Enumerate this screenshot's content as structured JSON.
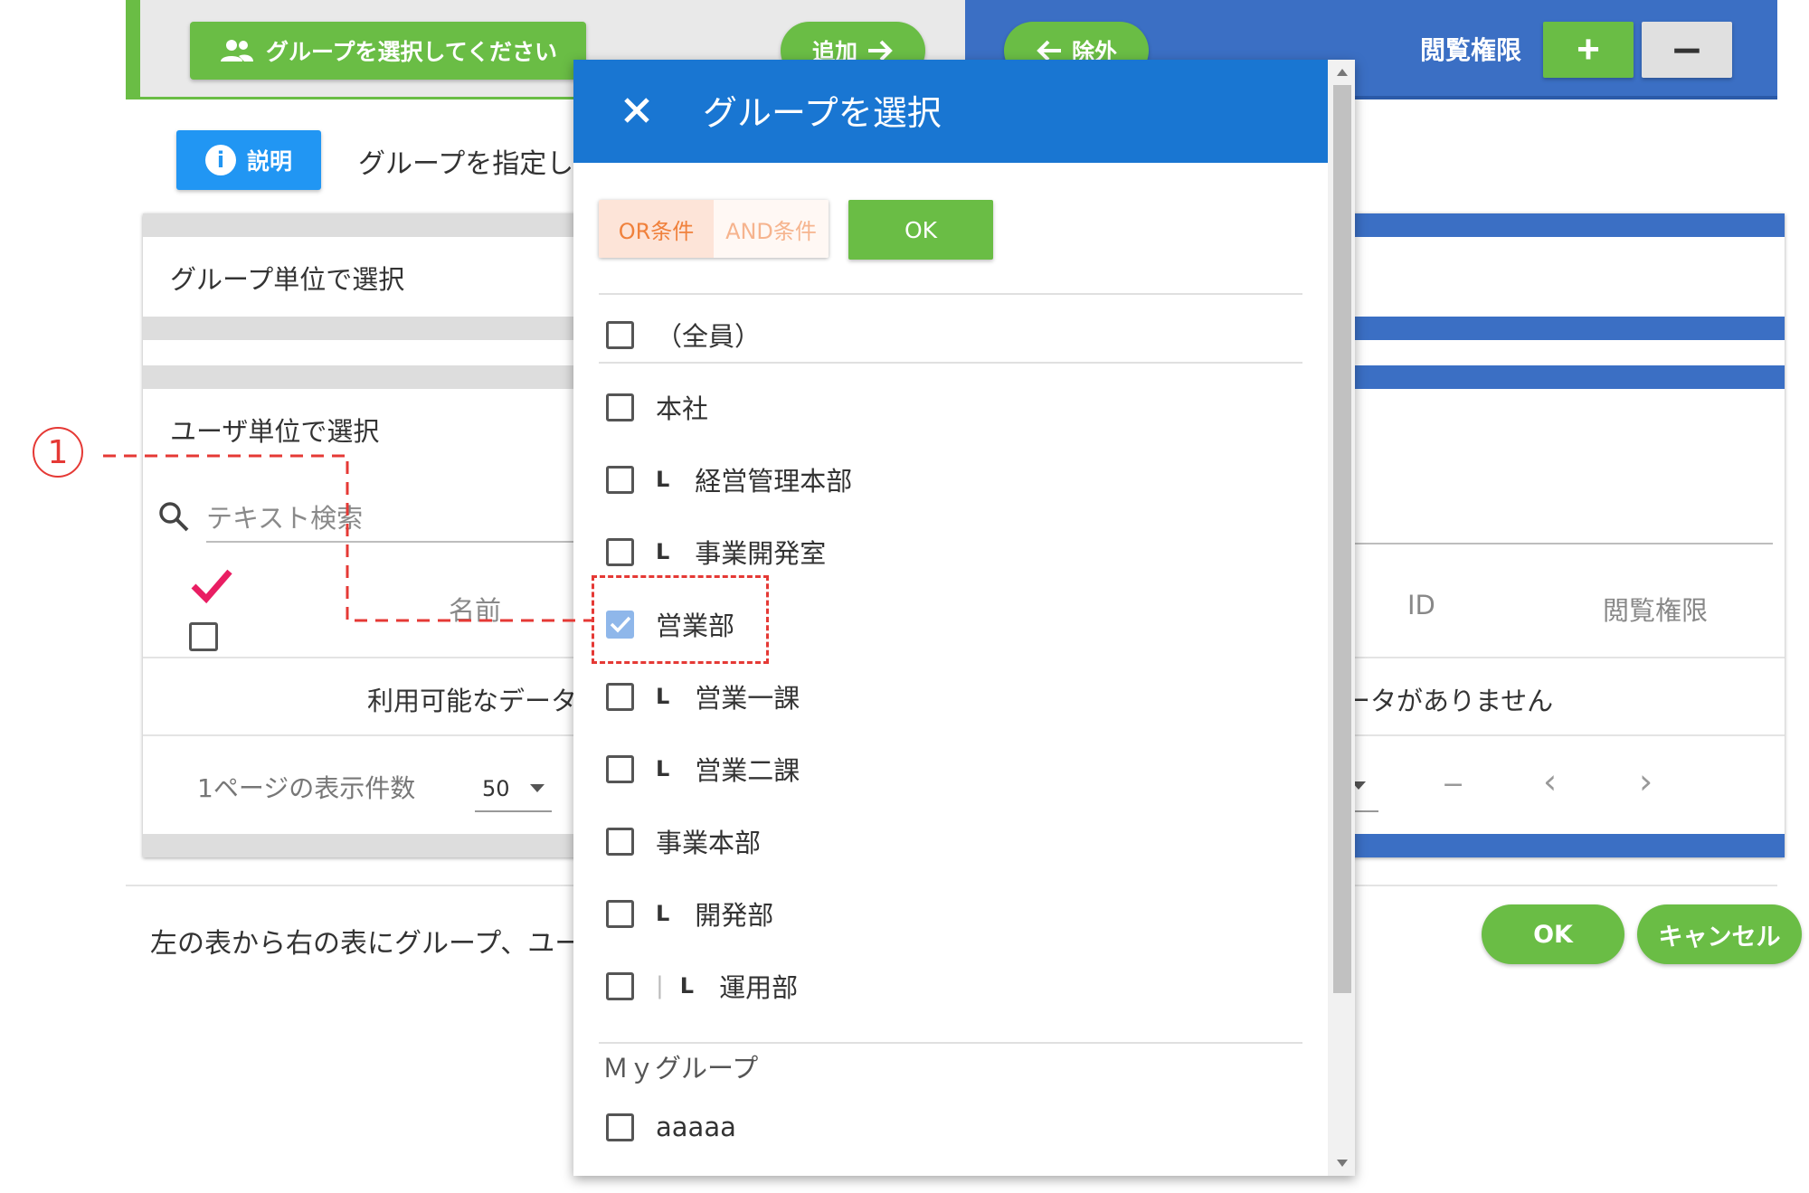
{
  "toolbar": {
    "select_group_label": "グループを選択してください",
    "add_label": "追加",
    "exclude_label": "除外",
    "permission_label": "閲覧権限",
    "plus_label": "+",
    "minus_label": "−"
  },
  "help": {
    "button_label": "説明",
    "description": "グループを指定し"
  },
  "left_panel": {
    "group_unit_header": "グループ単位で選択",
    "user_unit_header": "ユーザ単位で選択",
    "search_placeholder": "テキスト検索",
    "col_name": "名前",
    "no_data": "利用可能なデータ",
    "rows_per_page_label": "1ページの表示件数",
    "rows_per_page_value": "50"
  },
  "right_panel": {
    "col_id": "ID",
    "col_permission": "閲覧権限",
    "no_data": "ータがありません",
    "pager_dash": "−",
    "pager_prev": "‹",
    "pager_next": "›"
  },
  "footer": {
    "text": "左の表から右の表にグループ、ユー",
    "ok_label": "OK",
    "cancel_label": "キャンセル"
  },
  "annotation": {
    "number": "1"
  },
  "modal": {
    "title": "グループを選択",
    "or_label": "OR条件",
    "and_label": "AND条件",
    "ok_label": "OK",
    "indent_mark": "L",
    "items": [
      {
        "label": "（全員）",
        "checked": false
      },
      {
        "label": "本社",
        "checked": false
      },
      {
        "label": "経営管理本部",
        "checked": false
      },
      {
        "label": "事業開発室",
        "checked": false
      },
      {
        "label": "営業部",
        "checked": true
      },
      {
        "label": "営業一課",
        "checked": false
      },
      {
        "label": "営業二課",
        "checked": false
      },
      {
        "label": "事業本部",
        "checked": false
      },
      {
        "label": "開発部",
        "checked": false
      },
      {
        "label": "運用部",
        "checked": false
      }
    ],
    "mygroup_header": "Ｍｙグループ",
    "mygroup_items": [
      {
        "label": "aaaaa",
        "checked": false
      }
    ]
  },
  "colors": {
    "green": "#6abd45",
    "blue_header": "#1976d2",
    "blue_bar": "#3b6fc4",
    "annotation_red": "#e53935",
    "or_orange": "#f0813c"
  }
}
